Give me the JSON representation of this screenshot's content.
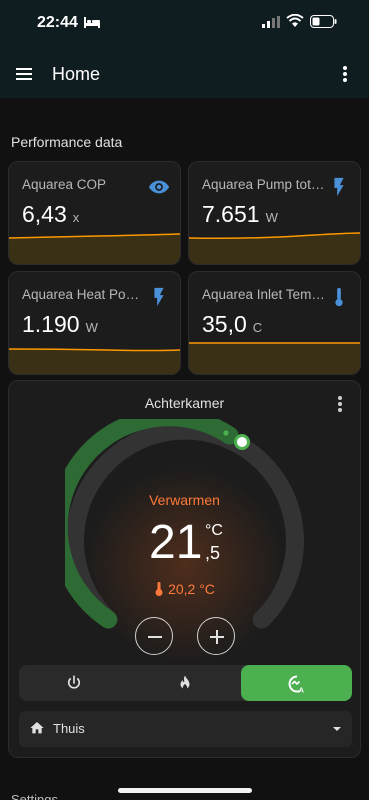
{
  "status_bar": {
    "time": "22:44"
  },
  "app_bar": {
    "title": "Home"
  },
  "section": {
    "title": "Performance data"
  },
  "sensors": [
    {
      "name": "Aquarea COP",
      "value": "6,43",
      "unit": "x",
      "icon": "eye-icon",
      "icon_color": "#4a90d9"
    },
    {
      "name": "Aquarea Pump tot…",
      "value": "7.651",
      "unit": "W",
      "icon": "flash-icon",
      "icon_color": "#4a90d9"
    },
    {
      "name": "Aquarea Heat Pow…",
      "value": "1.190",
      "unit": "W",
      "icon": "flash-icon",
      "icon_color": "#4a90d9"
    },
    {
      "name": "Aquarea Inlet Tem…",
      "value": "35,0",
      "unit": "C",
      "icon": "thermometer-icon",
      "icon_color": "#4a90d9"
    }
  ],
  "thermostat": {
    "name": "Achterkamer",
    "hvac_action": "Verwarmen",
    "target_whole": "21",
    "target_decimal": ",5",
    "unit": "°C",
    "current": "20,2 °C",
    "modes": [
      "off",
      "heat",
      "auto"
    ],
    "active_mode": "auto",
    "preset": "Thuis"
  },
  "next_section": {
    "title": "Settings"
  },
  "colors": {
    "accent_green": "#4caf50",
    "heat_orange": "#ff7a3a",
    "spark_line": "#ff9800",
    "icon_blue": "#4a90d9"
  }
}
